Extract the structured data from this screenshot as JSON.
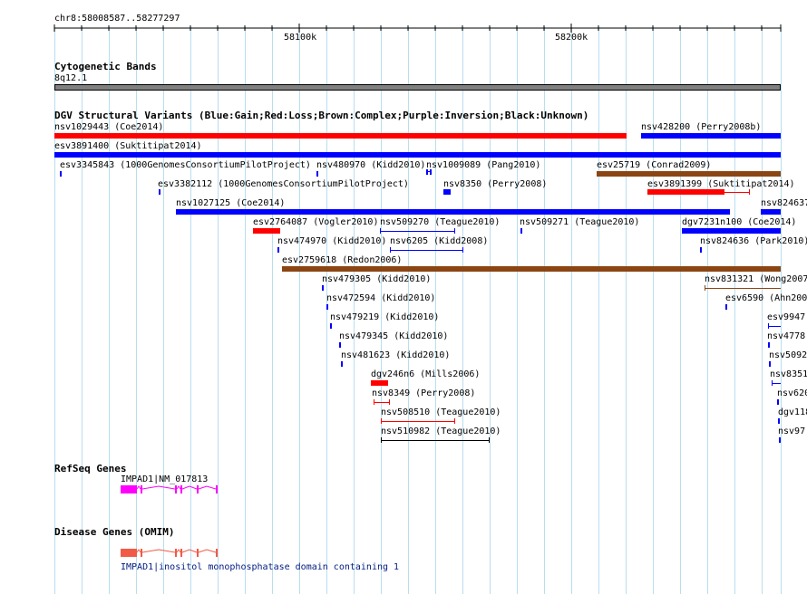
{
  "ruler": {
    "position": "chr8:58008587..58277297",
    "ticks": [
      "58100k",
      "58200k"
    ]
  },
  "tracks": {
    "cytoband": {
      "title": "Cytogenetic Bands",
      "band": "8q12.1"
    },
    "dgv": {
      "title": "DGV Structural Variants (Blue:Gain;Red:Loss;Brown:Complex;Purple:Inversion;Black:Unknown)",
      "legend_colors": {
        "gain": "#0000ff",
        "loss": "#ff0000",
        "complex": "#8b4513",
        "unknown": "#000000"
      }
    },
    "refseq": {
      "title": "RefSeq Genes",
      "gene": "IMPAD1|NM_017813",
      "color": "#ff00ff"
    },
    "omim": {
      "title": "Disease Genes (OMIM)",
      "gene": "IMPAD1|inositol monophosphatase domain containing 1",
      "color": "#f05a46"
    }
  },
  "variants": [
    {
      "id": "v1",
      "label": "nsv1029443 (Coe2014)"
    },
    {
      "id": "v2",
      "label": "nsv428200 (Perry2008b)"
    },
    {
      "id": "v3",
      "label": "esv3891400 (Suktitipat2014)"
    },
    {
      "id": "v4",
      "label": "esv3345843 (1000GenomesConsortiumPilotProject)"
    },
    {
      "id": "v5",
      "label": "nsv480970 (Kidd2010)"
    },
    {
      "id": "v6",
      "label": "nsv1009089 (Pang2010)"
    },
    {
      "id": "v7",
      "label": "esv25719 (Conrad2009)"
    },
    {
      "id": "v8",
      "label": "esv3382112 (1000GenomesConsortiumPilotProject)"
    },
    {
      "id": "v9",
      "label": "nsv8350 (Perry2008)"
    },
    {
      "id": "v10",
      "label": "esv3891399 (Suktitipat2014)"
    },
    {
      "id": "v11",
      "label": "nsv1027125 (Coe2014)"
    },
    {
      "id": "v12",
      "label": "nsv824637"
    },
    {
      "id": "v13",
      "label": "esv2764087 (Vogler2010)"
    },
    {
      "id": "v14",
      "label": "nsv509270 (Teague2010)"
    },
    {
      "id": "v15",
      "label": "nsv509271 (Teague2010)"
    },
    {
      "id": "v16",
      "label": "dgv7231n100 (Coe2014)"
    },
    {
      "id": "v17",
      "label": "nsv474970 (Kidd2010)"
    },
    {
      "id": "v18",
      "label": "nsv6205 (Kidd2008)"
    },
    {
      "id": "v19",
      "label": "nsv824636 (Park2010)"
    },
    {
      "id": "v20",
      "label": "esv2759618 (Redon2006)"
    },
    {
      "id": "v21",
      "label": "nsv479305 (Kidd2010)"
    },
    {
      "id": "v22",
      "label": "nsv831321 (Wong2007"
    },
    {
      "id": "v23",
      "label": "nsv472594 (Kidd2010)"
    },
    {
      "id": "v24",
      "label": "esv6590 (Ahn200"
    },
    {
      "id": "v25",
      "label": "nsv479219 (Kidd2010)"
    },
    {
      "id": "v26",
      "label": "esv9947"
    },
    {
      "id": "v27",
      "label": "nsv479345 (Kidd2010)"
    },
    {
      "id": "v28",
      "label": "nsv4778"
    },
    {
      "id": "v29",
      "label": "nsv481623 (Kidd2010)"
    },
    {
      "id": "v30",
      "label": "nsv5092"
    },
    {
      "id": "v31",
      "label": "dgv246n6 (Mills2006)"
    },
    {
      "id": "v32",
      "label": "nsv8351"
    },
    {
      "id": "v33",
      "label": "nsv8349 (Perry2008)"
    },
    {
      "id": "v34",
      "label": "nsv620"
    },
    {
      "id": "v35",
      "label": "nsv508510 (Teague2010)"
    },
    {
      "id": "v36",
      "label": "dgv118"
    },
    {
      "id": "v37",
      "label": "nsv510982 (Teague2010)"
    },
    {
      "id": "v38",
      "label": "nsv97"
    }
  ]
}
